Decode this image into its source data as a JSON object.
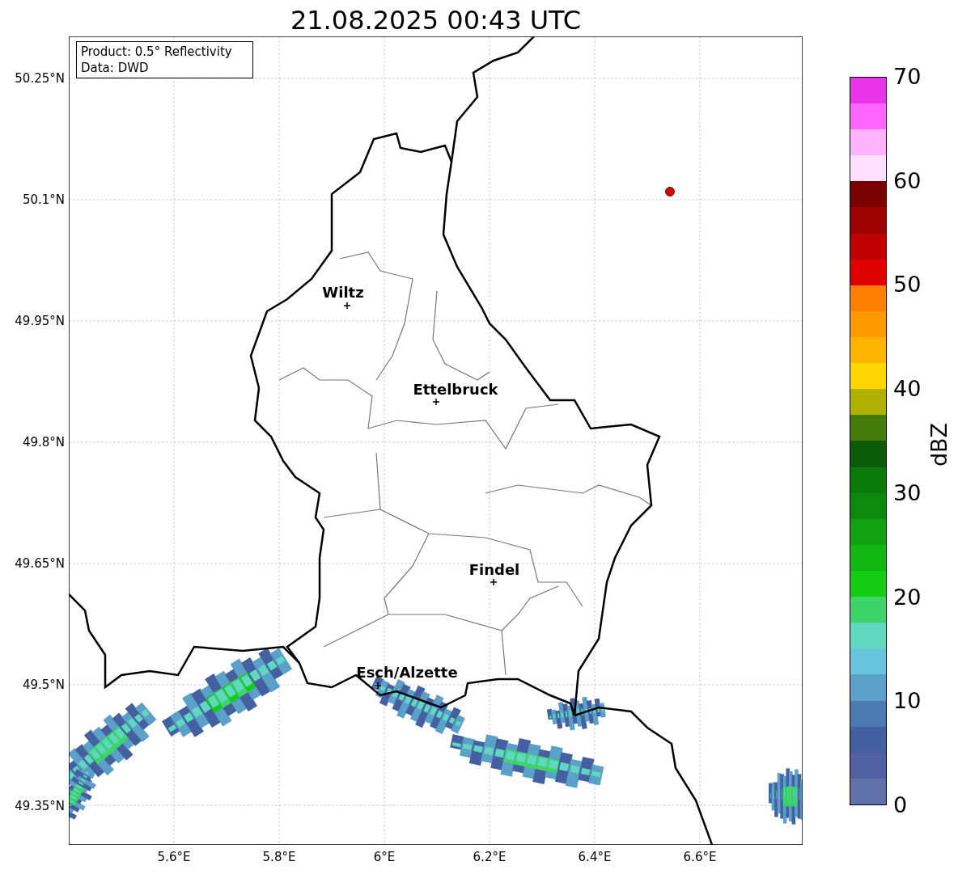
{
  "title": "21.08.2025 00:43 UTC",
  "info_box": [
    "Product: 0.5° Reflectivity",
    "Data: DWD"
  ],
  "map": {
    "x_ticks": [
      "5.6°E",
      "5.8°E",
      "6°E",
      "6.2°E",
      "6.4°E",
      "6.6°E"
    ],
    "y_ticks": [
      "50.25°N",
      "50.1°N",
      "49.95°N",
      "49.8°N",
      "49.65°N",
      "49.5°N",
      "49.35°N"
    ],
    "places": [
      {
        "name": "Wiltz"
      },
      {
        "name": "Ettelbruck"
      },
      {
        "name": "Findel"
      },
      {
        "name": "Esch/Alzette"
      }
    ]
  },
  "colorbar": {
    "label": "dBZ",
    "ticks": [
      "70",
      "60",
      "50",
      "40",
      "30",
      "20",
      "10",
      "0"
    ],
    "segments": [
      {
        "color": "#6070a8"
      },
      {
        "color": "#5060a0"
      },
      {
        "color": "#4560a0"
      },
      {
        "color": "#4a7ab0"
      },
      {
        "color": "#5aa0c8"
      },
      {
        "color": "#66c4dc"
      },
      {
        "color": "#60d8c0"
      },
      {
        "color": "#3dd46a"
      },
      {
        "color": "#14cc14"
      },
      {
        "color": "#12b812"
      },
      {
        "color": "#10a010"
      },
      {
        "color": "#0d8a0d"
      },
      {
        "color": "#0a7a0a"
      },
      {
        "color": "#0a5a0a"
      },
      {
        "color": "#467a0a"
      },
      {
        "color": "#b0b000"
      },
      {
        "color": "#ffd700"
      },
      {
        "color": "#ffb400"
      },
      {
        "color": "#ff9900"
      },
      {
        "color": "#ff7f00"
      },
      {
        "color": "#e00000"
      },
      {
        "color": "#c00000"
      },
      {
        "color": "#9e0000"
      },
      {
        "color": "#7a0000"
      },
      {
        "color": "#ffe0ff"
      },
      {
        "color": "#ffb3ff"
      },
      {
        "color": "#ff66ff"
      },
      {
        "color": "#e933e9"
      }
    ]
  }
}
